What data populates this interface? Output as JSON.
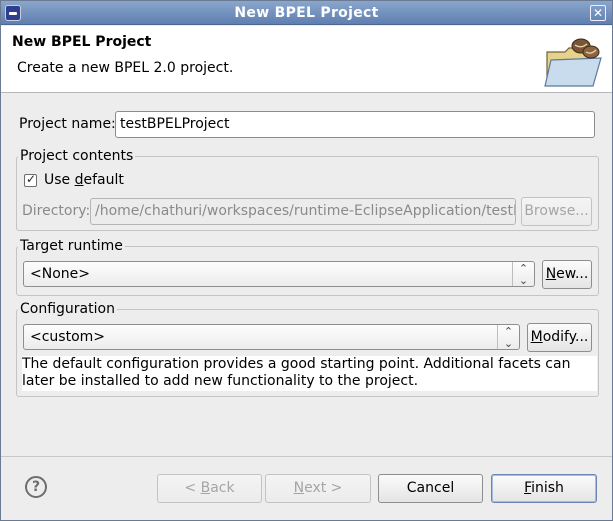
{
  "window": {
    "title": "New BPEL Project",
    "close_glyph": "✕"
  },
  "banner": {
    "title": "New BPEL Project",
    "description": "Create a new BPEL 2.0 project.",
    "icon": "folder-beans-icon"
  },
  "project_name": {
    "label": "Project name:",
    "value": "testBPELProject"
  },
  "project_contents": {
    "title": "Project contents",
    "use_default": {
      "before": "Use ",
      "mnemonic": "d",
      "after": "efault",
      "checked": true
    },
    "directory_label": "Directory:",
    "directory_value": "/home/chathuri/workspaces/runtime-EclipseApplication/testBPEL",
    "browse_label": "Browse..."
  },
  "target_runtime": {
    "title": "Target runtime",
    "selected": "<None>",
    "new_button": {
      "mnemonic": "N",
      "rest": "ew..."
    }
  },
  "configuration": {
    "title": "Configuration",
    "selected": "<custom>",
    "modify_button": {
      "mnemonic": "M",
      "rest": "odify..."
    },
    "description": "The default configuration provides a good starting point. Additional facets can later be installed to add new functionality to the project."
  },
  "footer": {
    "help_glyph": "?",
    "back": {
      "prefix": "< ",
      "mnemonic": "B",
      "rest": "ack"
    },
    "next": {
      "mnemonic": "N",
      "rest": "ext >"
    },
    "cancel": "Cancel",
    "finish": {
      "mnemonic": "F",
      "rest": "inish"
    }
  },
  "colors": {
    "titlebar": "#6f8ec0",
    "default_button_border": "#6b86b3"
  }
}
